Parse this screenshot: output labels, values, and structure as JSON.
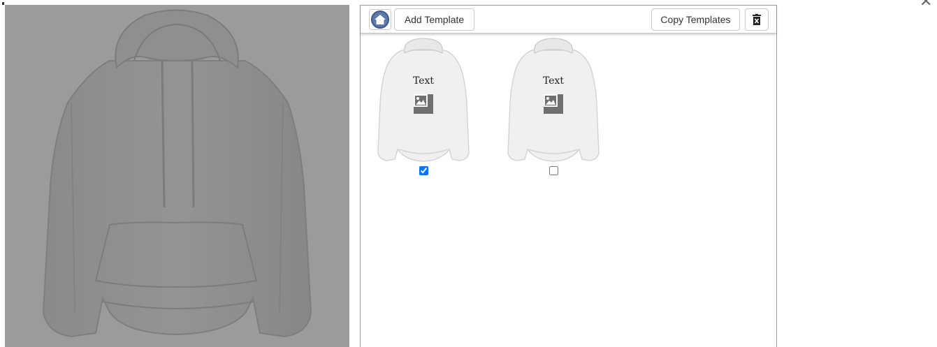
{
  "toolbar": {
    "home_icon": "home-icon",
    "add_template_label": "Add Template",
    "copy_templates_label": "Copy Templates",
    "delete_icon": "trash-icon"
  },
  "preview": {
    "background_color": "#9b9b9b",
    "garment": "hoodie"
  },
  "templates": [
    {
      "text": "Text",
      "image_icon": "image-placeholder-icon",
      "checked": true
    },
    {
      "text": "Text",
      "image_icon": "image-placeholder-icon",
      "checked": false
    }
  ],
  "close_icon": "close-icon"
}
